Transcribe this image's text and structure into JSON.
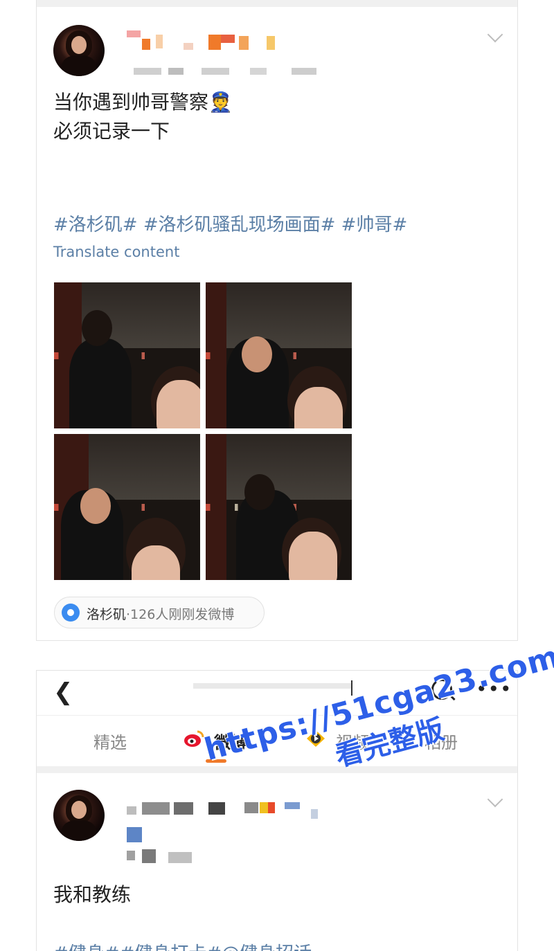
{
  "post1": {
    "text_lines": [
      "当你遇到帅哥警察👮",
      "必须记录一下"
    ],
    "tags": "#洛杉矶# #洛杉矶骚乱现场画面# #帅哥#",
    "translate_label": "Translate content",
    "location": {
      "city": "洛杉矶",
      "count_text": "·126人刚刚发微博"
    }
  },
  "profile_nav": {
    "back_icon": "chevron-left-icon",
    "search_icon": "search-icon",
    "more_label": "•••"
  },
  "tabs": [
    {
      "label": "精选"
    },
    {
      "label": "微博"
    },
    {
      "label": "视频"
    },
    {
      "label": "相册"
    }
  ],
  "post2": {
    "text": "我和教练",
    "tags": "#健身##健身打卡#@健身招话"
  },
  "watermark": {
    "url": "https://51cga23.com",
    "subtitle": "看完整版"
  },
  "colors": {
    "link": "#5b7fa6",
    "accent": "#f07a2a",
    "watermark": "#2d5fe8",
    "pin": "#3b8cf0"
  }
}
